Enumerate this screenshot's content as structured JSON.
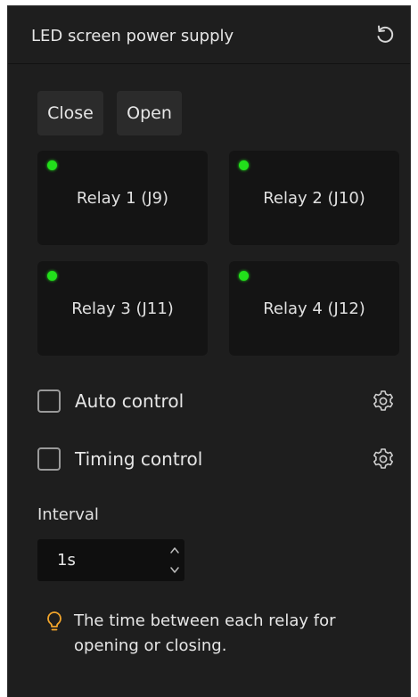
{
  "panel": {
    "title": "LED screen power supply",
    "refresh_icon": "refresh-icon"
  },
  "actions": {
    "close_label": "Close",
    "open_label": "Open"
  },
  "relays": [
    {
      "label": "Relay 1 (J9)",
      "status_color": "#22e01b"
    },
    {
      "label": "Relay 2 (J10)",
      "status_color": "#22e01b"
    },
    {
      "label": "Relay 3 (J11)",
      "status_color": "#22e01b"
    },
    {
      "label": "Relay 4 (J12)",
      "status_color": "#22e01b"
    }
  ],
  "options": {
    "auto_control": {
      "label": "Auto control",
      "checked": false,
      "icon": "gear-icon"
    },
    "timing_control": {
      "label": "Timing control",
      "checked": false,
      "icon": "gear-icon"
    }
  },
  "interval": {
    "label": "Interval",
    "value": "1s"
  },
  "hint": {
    "icon": "lightbulb-icon",
    "icon_color": "#f2a52b",
    "text": "The time between each relay for opening or closing."
  },
  "colors": {
    "panel_bg": "#1e1e1e",
    "relay_bg": "#141414",
    "button_bg": "#2b2b2b",
    "status_green": "#22e01b"
  }
}
